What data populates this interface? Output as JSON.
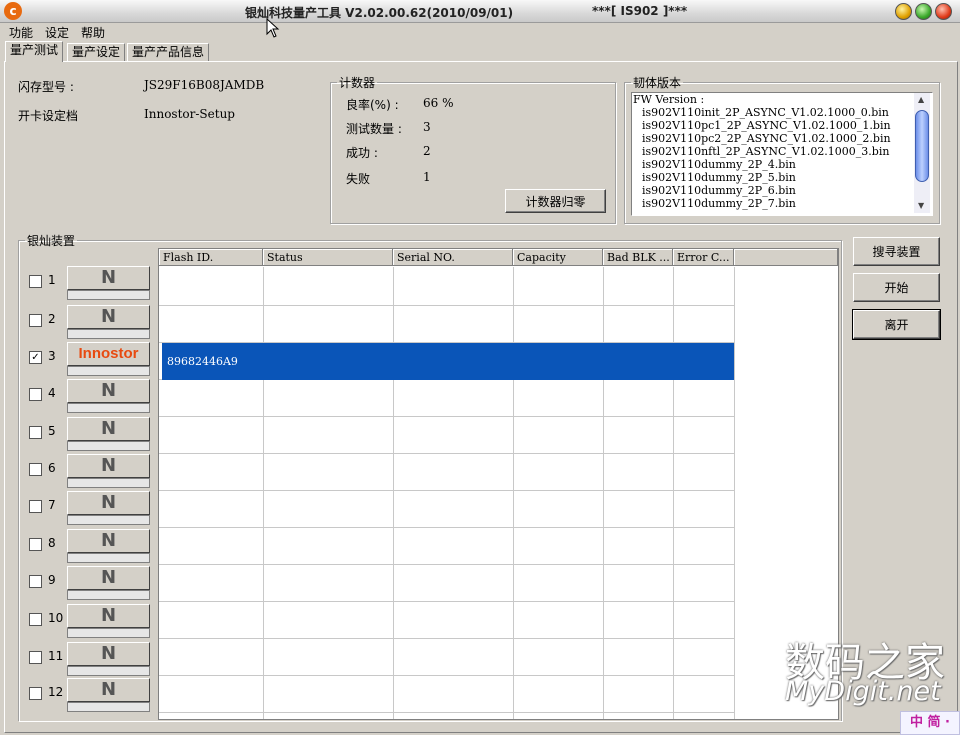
{
  "window": {
    "title": "银灿科技量产工具 V2.02.00.62(2010/09/01)",
    "subtitle": "***[ IS902 ]***"
  },
  "menu": [
    "功能",
    "设定",
    "帮助"
  ],
  "tabs": [
    "量产测试",
    "量产设定",
    "量产产品信息"
  ],
  "info": {
    "flash_model_label": "闪存型号 :",
    "flash_model_value": "JS29F16B08JAMDB",
    "card_profile_label": "开卡设定档",
    "card_profile_value": "Innostor-Setup"
  },
  "counter": {
    "title": "计数器",
    "yield_label": "良率(%) :",
    "yield_value": "66 %",
    "tested_label": "测试数量 :",
    "tested_value": "3",
    "success_label": "成功 :",
    "success_value": "2",
    "fail_label": "失败",
    "fail_value": "1",
    "reset_button": "计数器归零"
  },
  "firmware": {
    "title": "韧体版本",
    "lines": [
      "FW Version :",
      "is902V110init_2P_ASYNC_V1.02.1000_0.bin",
      "is902V110pc1_2P_ASYNC_V1.02.1000_1.bin",
      "is902V110pc2_2P_ASYNC_V1.02.1000_2.bin",
      "is902V110nftl_2P_ASYNC_V1.02.1000_3.bin",
      "is902V110dummy_2P_4.bin",
      "is902V110dummy_2P_5.bin",
      "is902V110dummy_2P_6.bin",
      "is902V110dummy_2P_7.bin"
    ]
  },
  "devices": {
    "title": "银灿装置",
    "rows": [
      {
        "num": "1",
        "badge": "N",
        "checked": false
      },
      {
        "num": "2",
        "badge": "N",
        "checked": false
      },
      {
        "num": "3",
        "badge": "Innostor",
        "checked": true
      },
      {
        "num": "4",
        "badge": "N",
        "checked": false
      },
      {
        "num": "5",
        "badge": "N",
        "checked": false
      },
      {
        "num": "6",
        "badge": "N",
        "checked": false
      },
      {
        "num": "7",
        "badge": "N",
        "checked": false
      },
      {
        "num": "8",
        "badge": "N",
        "checked": false
      },
      {
        "num": "9",
        "badge": "N",
        "checked": false
      },
      {
        "num": "10",
        "badge": "N",
        "checked": false
      },
      {
        "num": "11",
        "badge": "N",
        "checked": false
      },
      {
        "num": "12",
        "badge": "N",
        "checked": false
      }
    ],
    "columns": [
      "Flash ID.",
      "Status",
      "Serial NO.",
      "Capacity",
      "Bad BLK ...",
      "Error C..."
    ],
    "selected_flash_id": "89682446A9"
  },
  "buttons": {
    "search": "搜寻装置",
    "start": "开始",
    "exit": "离开"
  },
  "watermark": {
    "cn": "数码之家",
    "en": "MyDigit.net",
    "ime": "中 简 ·"
  },
  "colors": {
    "selection": "#0a55b8",
    "innostor_badge": "#e84a10"
  }
}
